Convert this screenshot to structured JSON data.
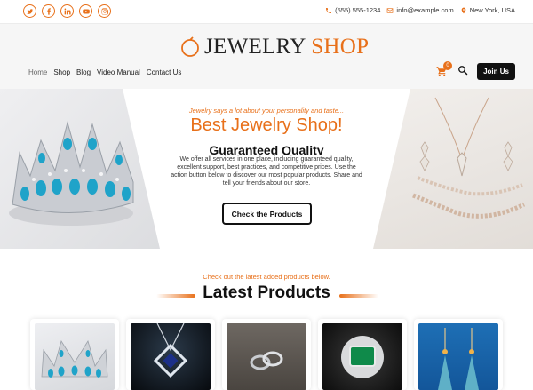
{
  "topbar": {
    "social": [
      "twitter-icon",
      "facebook-icon",
      "linkedin-icon",
      "youtube-icon",
      "instagram-icon"
    ],
    "phone": "(555) 555-1234",
    "email": "info@example.com",
    "location": "New York, USA"
  },
  "header": {
    "logo_main": "JEWELRY ",
    "logo_accent": "SHOP",
    "nav": [
      {
        "label": "Home"
      },
      {
        "label": "Shop"
      },
      {
        "label": "Blog"
      },
      {
        "label": "Video Manual"
      },
      {
        "label": "Contact Us"
      }
    ],
    "cart_count": "0",
    "join_label": "Join Us"
  },
  "hero": {
    "tagline": "Jewelry says a lot about your personality and taste...",
    "title": "Best Jewelry Shop!",
    "subtitle": "Guaranteed Quality",
    "description": "We offer all services in one place, including guaranteed quality, excellent support, best practices, and competitive prices. Use the action button below to discover our most popular products. Share and tell your friends about our store.",
    "button_label": "Check the Products"
  },
  "latest": {
    "note": "Check out the latest added products below.",
    "title": "Latest Products"
  },
  "colors": {
    "accent": "#e8701a",
    "dark": "#111111"
  }
}
